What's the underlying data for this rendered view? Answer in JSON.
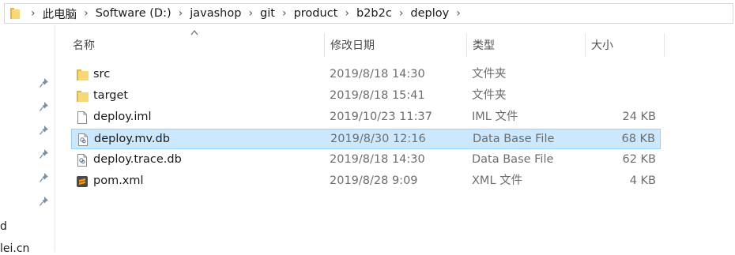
{
  "address_bar": {
    "crumbs": [
      "此电脑",
      "Software (D:)",
      "javashop",
      "git",
      "product",
      "b2b2c",
      "deploy"
    ]
  },
  "columns": {
    "name": "名称",
    "date": "修改日期",
    "type": "类型",
    "size": "大小"
  },
  "files": [
    {
      "name": "src",
      "date": "2019/8/18 14:30",
      "type": "文件夹",
      "size": "",
      "icon": "folder-icon"
    },
    {
      "name": "target",
      "date": "2019/8/18 15:41",
      "type": "文件夹",
      "size": "",
      "icon": "folder-icon"
    },
    {
      "name": "deploy.iml",
      "date": "2019/10/23 11:37",
      "type": "IML 文件",
      "size": "24 KB",
      "icon": "file-icon"
    },
    {
      "name": "deploy.mv.db",
      "date": "2019/8/30 12:16",
      "type": "Data Base File",
      "size": "68 KB",
      "icon": "db-file-icon",
      "selected": true
    },
    {
      "name": "deploy.trace.db",
      "date": "2019/8/18 14:30",
      "type": "Data Base File",
      "size": "62 KB",
      "icon": "db-file-icon"
    },
    {
      "name": "pom.xml",
      "date": "2019/8/28 9:09",
      "type": "XML 文件",
      "size": "4 KB",
      "icon": "sublime-file-icon"
    }
  ],
  "nav_fragments": [
    "d",
    "lei.cn"
  ],
  "colors": {
    "selection_bg": "#cce8ff",
    "selection_border": "#99d1ff",
    "folder_yellow": "#f8d775"
  }
}
